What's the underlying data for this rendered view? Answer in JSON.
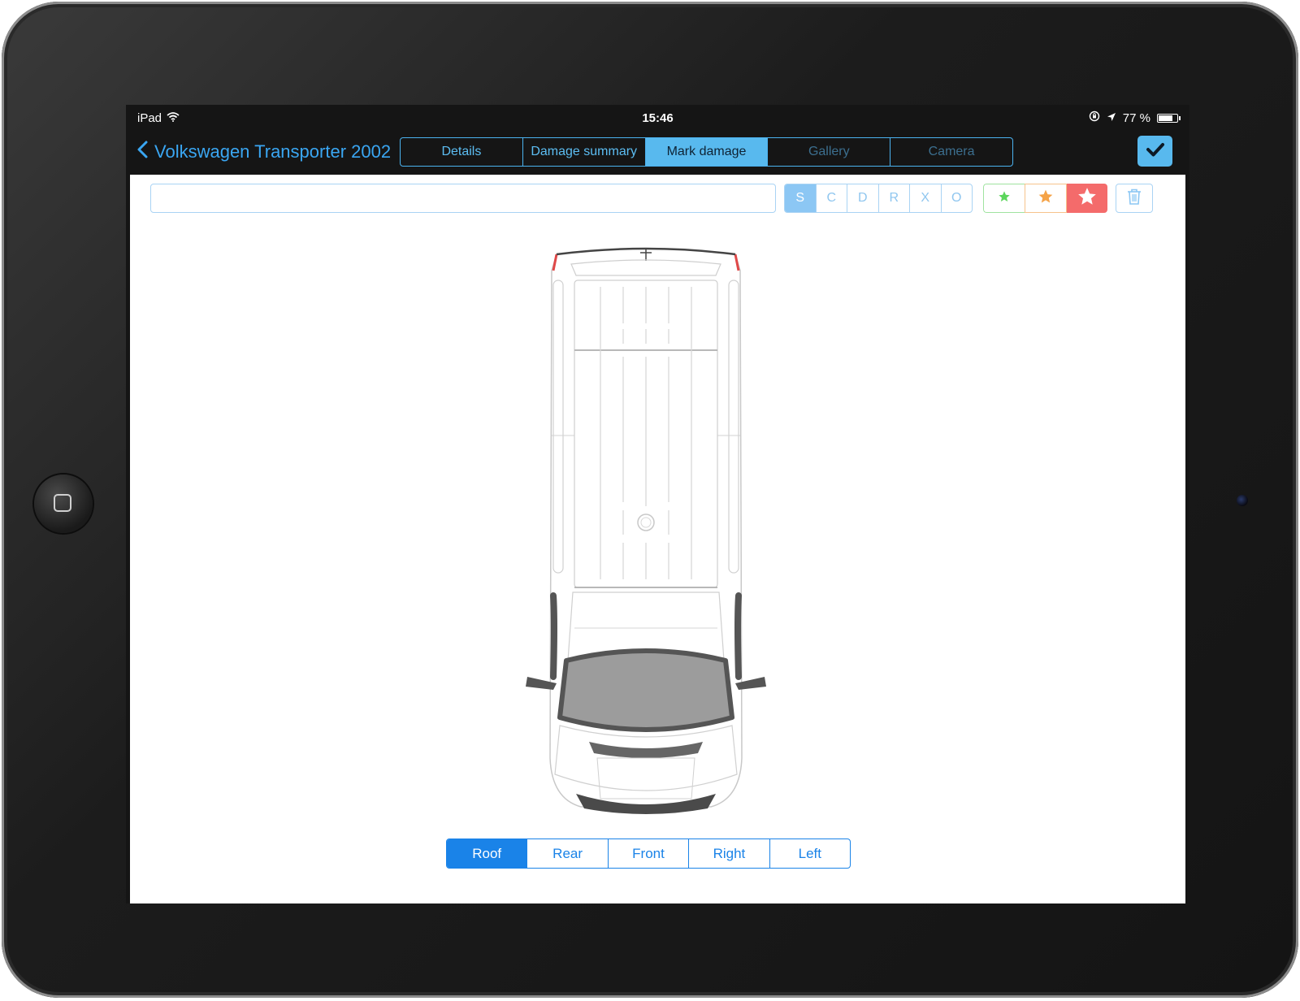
{
  "status_bar": {
    "device": "iPad",
    "time": "15:46",
    "battery": "77 %",
    "battery_level": 0.77,
    "icons": [
      "wifi-icon",
      "rotation-lock-icon",
      "location-icon",
      "battery-icon"
    ]
  },
  "nav": {
    "back_label": "Volkswagen Transporter 2002",
    "tabs": [
      {
        "label": "Details",
        "state": "normal"
      },
      {
        "label": "Damage summary",
        "state": "normal"
      },
      {
        "label": "Mark damage",
        "state": "active"
      },
      {
        "label": "Gallery",
        "state": "disabled"
      },
      {
        "label": "Camera",
        "state": "disabled"
      }
    ],
    "confirm_icon": "checkmark-icon"
  },
  "toolbar": {
    "comment_value": "",
    "damage_types": [
      "S",
      "C",
      "D",
      "R",
      "X",
      "O"
    ],
    "selected_type": "S",
    "severity": [
      {
        "icon": "star-small-icon",
        "color": "#5cd65c"
      },
      {
        "icon": "star-medium-icon",
        "color": "#f5a347"
      },
      {
        "icon": "star-large-icon",
        "color": "#ffffff",
        "selected": true
      }
    ],
    "delete_icon": "trash-icon"
  },
  "views": {
    "items": [
      "Roof",
      "Rear",
      "Front",
      "Right",
      "Left"
    ],
    "selected": "Roof"
  },
  "colors": {
    "accent": "#58b9ee",
    "view_accent": "#1a83e8",
    "severity_high": "#f46b6b"
  }
}
